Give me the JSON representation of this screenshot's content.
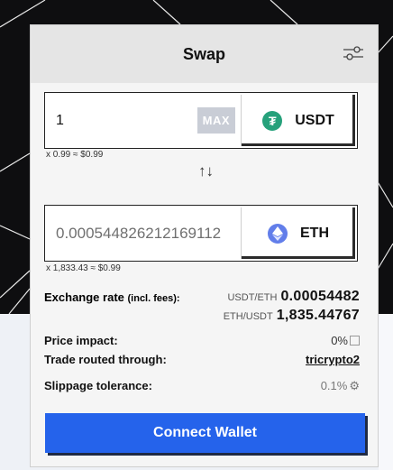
{
  "header": {
    "title": "Swap",
    "settings_icon": "sliders-icon"
  },
  "from": {
    "amount": "1",
    "max_label": "MAX",
    "token": "USDT",
    "token_icon": "tether-icon",
    "note": "x 0.99 ≈ $0.99"
  },
  "swap_direction_icon": "↑↓",
  "to": {
    "amount": "0.000544826212169112",
    "token": "ETH",
    "token_icon": "ethereum-icon",
    "note": "x 1,833.43 ≈ $0.99"
  },
  "info": {
    "exchange_rate_label": "Exchange rate",
    "exchange_rate_label_suffix": "(incl. fees):",
    "rate1_pair": "USDT/ETH",
    "rate1_value": "0.00054482",
    "rate2_pair": "ETH/USDT",
    "rate2_value": "1,835.44767",
    "price_impact_label": "Price impact:",
    "price_impact_value": "0%",
    "route_label": "Trade routed through:",
    "route_value": "tricrypto2",
    "slippage_label": "Slippage tolerance:",
    "slippage_value": "0.1%"
  },
  "connect_button": "Connect Wallet",
  "colors": {
    "accent": "#2563eb",
    "usdt": "#26a17b",
    "eth": "#627eea",
    "max_bg": "#c9cdd6"
  }
}
